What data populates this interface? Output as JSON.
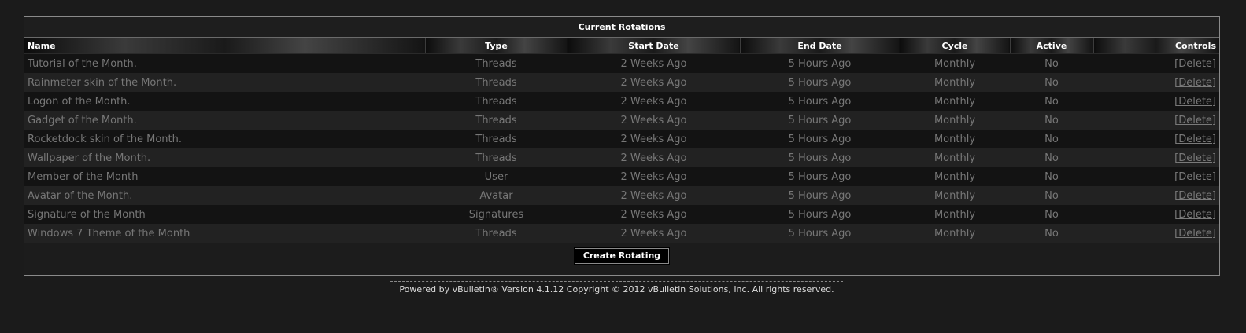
{
  "panel": {
    "title": "Current Rotations",
    "create_button": "Create Rotating"
  },
  "columns": [
    "Name",
    "Type",
    "Start Date",
    "End Date",
    "Cycle",
    "Active",
    "Controls"
  ],
  "rows": [
    {
      "name": "Tutorial of the Month.",
      "type": "Threads",
      "start": "2 Weeks Ago",
      "end": "5 Hours Ago",
      "cycle": "Monthly",
      "active": "No",
      "control": "[Delete]"
    },
    {
      "name": "Rainmeter skin of the Month.",
      "type": "Threads",
      "start": "2 Weeks Ago",
      "end": "5 Hours Ago",
      "cycle": "Monthly",
      "active": "No",
      "control": "[Delete]"
    },
    {
      "name": "Logon of the Month.",
      "type": "Threads",
      "start": "2 Weeks Ago",
      "end": "5 Hours Ago",
      "cycle": "Monthly",
      "active": "No",
      "control": "[Delete]"
    },
    {
      "name": "Gadget of the Month.",
      "type": "Threads",
      "start": "2 Weeks Ago",
      "end": "5 Hours Ago",
      "cycle": "Monthly",
      "active": "No",
      "control": "[Delete]"
    },
    {
      "name": "Rocketdock skin of the Month.",
      "type": "Threads",
      "start": "2 Weeks Ago",
      "end": "5 Hours Ago",
      "cycle": "Monthly",
      "active": "No",
      "control": "[Delete]"
    },
    {
      "name": "Wallpaper of the Month.",
      "type": "Threads",
      "start": "2 Weeks Ago",
      "end": "5 Hours Ago",
      "cycle": "Monthly",
      "active": "No",
      "control": "[Delete]"
    },
    {
      "name": "Member of the Month",
      "type": "User",
      "start": "2 Weeks Ago",
      "end": "5 Hours Ago",
      "cycle": "Monthly",
      "active": "No",
      "control": "[Delete]"
    },
    {
      "name": "Avatar of the Month.",
      "type": "Avatar",
      "start": "2 Weeks Ago",
      "end": "5 Hours Ago",
      "cycle": "Monthly",
      "active": "No",
      "control": "[Delete]"
    },
    {
      "name": "Signature of the Month",
      "type": "Signatures",
      "start": "2 Weeks Ago",
      "end": "5 Hours Ago",
      "cycle": "Monthly",
      "active": "No",
      "control": "[Delete]"
    },
    {
      "name": "Windows 7 Theme of the Month",
      "type": "Threads",
      "start": "2 Weeks Ago",
      "end": "5 Hours Ago",
      "cycle": "Monthly",
      "active": "No",
      "control": "[Delete]"
    }
  ],
  "footer": {
    "powered_by": "Powered by vBulletin® Version 4.1.12 Copyright © 2012 vBulletin Solutions, Inc. All rights reserved."
  },
  "colors": {
    "background": "#1b1b1b",
    "row_odd": "#131313",
    "row_even": "#222222",
    "text_muted": "#777777",
    "header_text": "#ffffff"
  }
}
